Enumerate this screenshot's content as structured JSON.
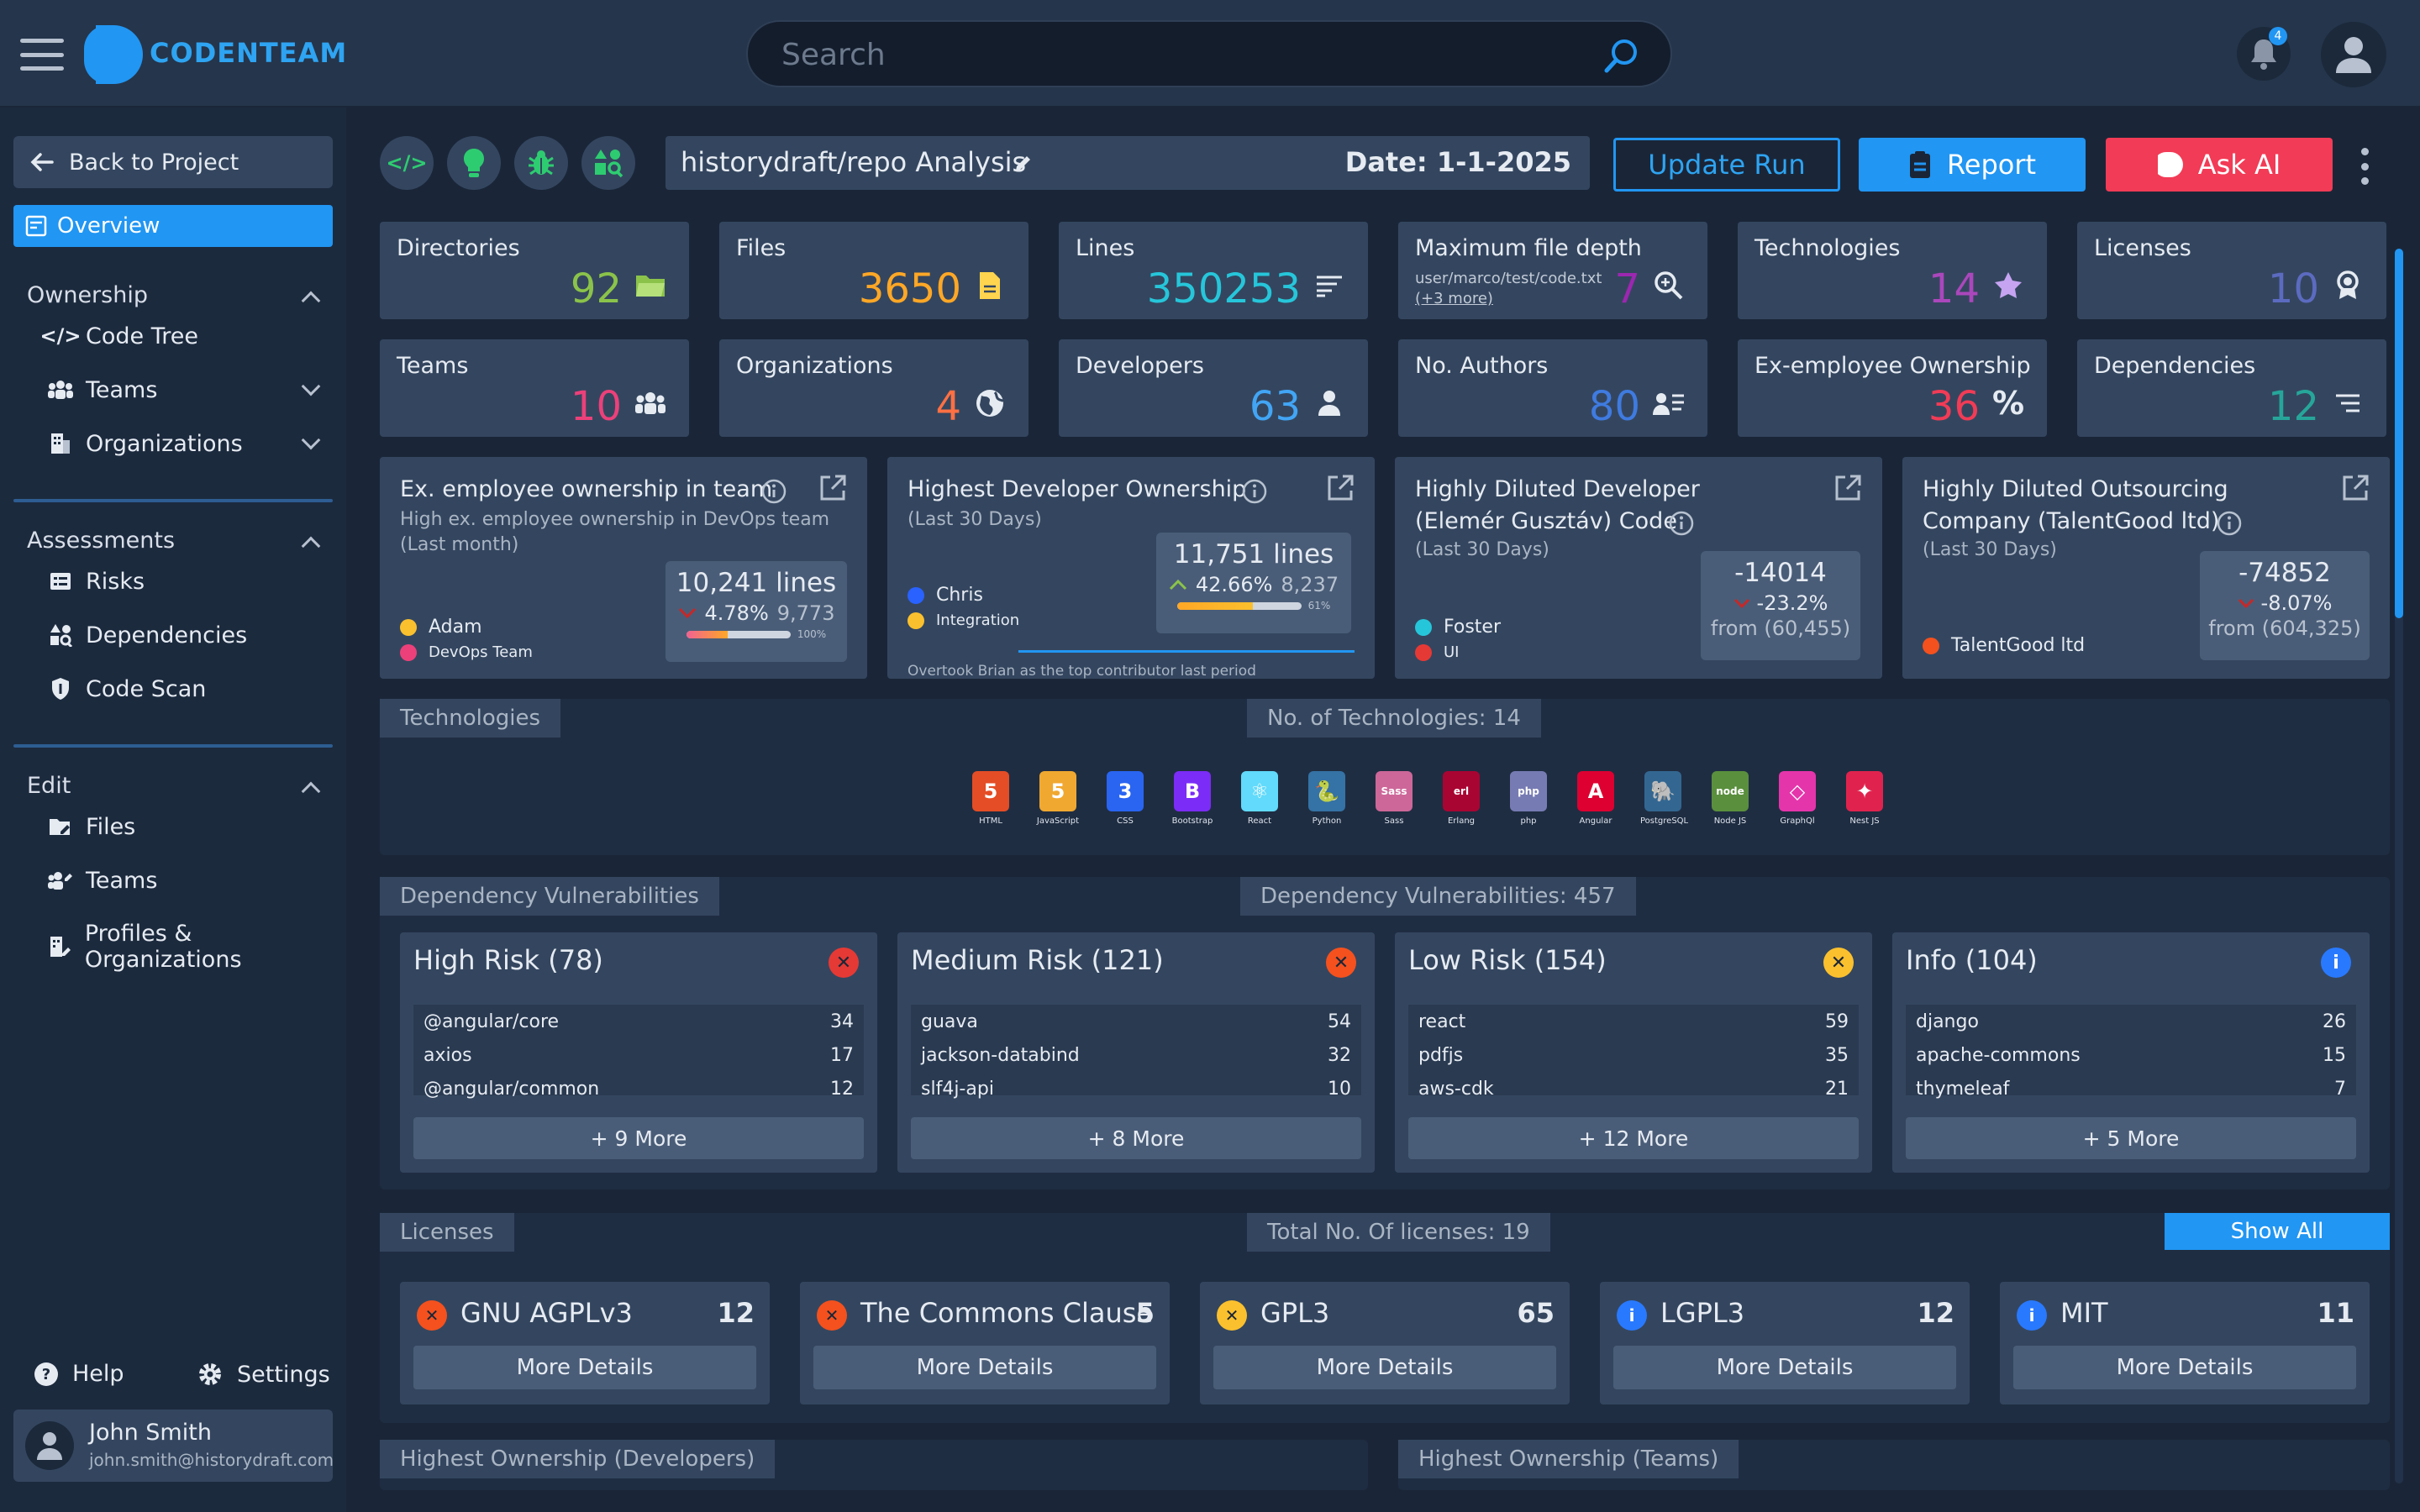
{
  "app": {
    "name": "CODENTEAM"
  },
  "search": {
    "placeholder": "Search"
  },
  "notifications": {
    "count": "4"
  },
  "sidebar": {
    "back": "Back to Project",
    "overview": "Overview",
    "ownership": "Ownership",
    "code_tree": "Code Tree",
    "teams": "Teams",
    "organizations": "Organizations",
    "assessments": "Assessments",
    "risks": "Risks",
    "dependencies": "Dependencies",
    "code_scan": "Code Scan",
    "edit": "Edit",
    "files": "Files",
    "edit_teams": "Teams",
    "profiles": "Profiles & Organizations",
    "help": "Help",
    "settings": "Settings",
    "user_name": "John Smith",
    "user_email": "john.smith@historydraft.com"
  },
  "toolbar": {
    "project": "historydraft/repo Analysis",
    "date": "Date: 1-1-2025",
    "update_run": "Update Run",
    "report": "Report",
    "ask_ai": "Ask AI"
  },
  "stats": [
    {
      "label": "Directories",
      "value": "92",
      "color": "#8bc34a",
      "icon": "folder-icon"
    },
    {
      "label": "Files",
      "value": "3650",
      "color": "#ffa726",
      "icon": "file-icon"
    },
    {
      "label": "Lines",
      "value": "350253",
      "color": "#26c6da",
      "icon": "lines-icon"
    },
    {
      "label": "Maximum file depth",
      "value": "7",
      "color": "#9c27b0",
      "icon": "zoom-icon",
      "sub": "user/marco/test/code.txt",
      "sub2": "(+3 more)"
    },
    {
      "label": "Technologies",
      "value": "14",
      "color": "#ab47bc",
      "icon": "star-icon"
    },
    {
      "label": "Licenses",
      "value": "10",
      "color": "#5c6bc0",
      "icon": "award-icon"
    },
    {
      "label": "Teams",
      "value": "10",
      "color": "#ec407a",
      "icon": "team-icon"
    },
    {
      "label": "Organizations",
      "value": "4",
      "color": "#ff7043",
      "icon": "globe-icon"
    },
    {
      "label": "Developers",
      "value": "63",
      "color": "#42a5f5",
      "icon": "person-icon"
    },
    {
      "label": "No. Authors",
      "value": "80",
      "color": "#3f7be0",
      "icon": "authors-icon"
    },
    {
      "label": "Ex-employee Ownership",
      "value": "36",
      "color": "#f23b56",
      "icon": "percent-icon"
    },
    {
      "label": "Dependencies",
      "value": "12",
      "color": "#26a69a",
      "icon": "list-icon"
    }
  ],
  "cards": {
    "c1": {
      "title": "Ex. employee ownership in team",
      "sub1": "High ex. employee ownership in DevOps team",
      "sub2": "(Last month)",
      "leg1": "Adam",
      "leg2": "DevOps Team",
      "big": "10,241 lines",
      "pct": "4.78%",
      "prev": "9,773",
      "bar": "100%",
      "fill": 0.4
    },
    "c2": {
      "title": "Highest Developer Ownership",
      "sub1": "(Last 30 Days)",
      "leg1": "Chris",
      "leg2": "Integration",
      "big": "11,751 lines",
      "pct": "42.66%",
      "prev": "8,237",
      "bar": "61%",
      "fill": 0.61,
      "note": "Overtook Brian as the top contributor last period"
    },
    "c3": {
      "title1": "Highly Diluted Developer",
      "title2": "(Elemér Gusztáv) Code",
      "sub1": "(Last 30 Days)",
      "leg1": "Foster",
      "leg2": "UI",
      "big": "-14014",
      "pct": "-23.2%",
      "from": "from (60,455)"
    },
    "c4": {
      "title1": "Highly Diluted Outsourcing",
      "title2": "Company (TalentGood ltd)",
      "sub1": "(Last 30 Days)",
      "leg1": "TalentGood ltd",
      "big": "-74852",
      "pct": "-8.07%",
      "from": "from (604,325)"
    }
  },
  "technologies": {
    "tag": "Technologies",
    "count": "No. of Technologies: 14",
    "items": [
      {
        "name": "HTML",
        "color": "#e44d26",
        "glyph": "5"
      },
      {
        "name": "JavaScript",
        "color": "#f0a830",
        "glyph": "5"
      },
      {
        "name": "CSS",
        "color": "#2965f1",
        "glyph": "3"
      },
      {
        "name": "Bootstrap",
        "color": "#7b2cf6",
        "glyph": "B"
      },
      {
        "name": "React",
        "color": "#61dafb",
        "glyph": "⚛"
      },
      {
        "name": "Python",
        "color": "#3572a5",
        "glyph": "🐍"
      },
      {
        "name": "Sass",
        "color": "#cd6799",
        "glyph": "Sass"
      },
      {
        "name": "Erlang",
        "color": "#a90533",
        "glyph": "erl"
      },
      {
        "name": "php",
        "color": "#777bb3",
        "glyph": "php"
      },
      {
        "name": "Angular",
        "color": "#dd0031",
        "glyph": "A"
      },
      {
        "name": "PostgreSQL",
        "color": "#336791",
        "glyph": "🐘"
      },
      {
        "name": "Node JS",
        "color": "#5a8f3d",
        "glyph": "node"
      },
      {
        "name": "GraphQl",
        "color": "#e535ab",
        "glyph": "◇"
      },
      {
        "name": "Nest JS",
        "color": "#e0234e",
        "glyph": "✦"
      }
    ]
  },
  "vulns": {
    "tag": "Dependency Vulnerabilities",
    "count": "Dependency Vulnerabilities: 457",
    "groups": [
      {
        "title": "High Risk (78)",
        "color": "#e53935",
        "mark": "✕",
        "rows": [
          [
            "@angular/core",
            "34"
          ],
          [
            "axios",
            "17"
          ],
          [
            "@angular/common",
            "12"
          ]
        ],
        "more": "+ 9 More"
      },
      {
        "title": "Medium Risk (121)",
        "color": "#f4511e",
        "mark": "✕",
        "rows": [
          [
            "guava",
            "54"
          ],
          [
            "jackson-databind",
            "32"
          ],
          [
            "slf4j-api",
            "10"
          ]
        ],
        "more": "+ 8 More"
      },
      {
        "title": "Low Risk (154)",
        "color": "#fbc02d",
        "mark": "✕",
        "rows": [
          [
            "react",
            "59"
          ],
          [
            "pdfjs",
            "35"
          ],
          [
            "aws-cdk",
            "21"
          ]
        ],
        "more": "+ 12 More"
      },
      {
        "title": "Info (104)",
        "color": "#2979ff",
        "mark": "i",
        "rows": [
          [
            "django",
            "26"
          ],
          [
            "apache-commons",
            "15"
          ],
          [
            "thymeleaf",
            "7"
          ]
        ],
        "more": "+ 5 More"
      }
    ]
  },
  "licenses": {
    "tag": "Licenses",
    "count": "Total No. Of licenses: 19",
    "show_all": "Show All",
    "details": "More Details",
    "items": [
      {
        "name": "GNU AGPLv3",
        "count": "12",
        "color": "#f4511e",
        "mark": "✕"
      },
      {
        "name": "The Commons Clause",
        "count": "5",
        "color": "#f4511e",
        "mark": "✕"
      },
      {
        "name": "GPL3",
        "count": "65",
        "color": "#fbc02d",
        "mark": "✕"
      },
      {
        "name": "LGPL3",
        "count": "12",
        "color": "#2979ff",
        "mark": "i"
      },
      {
        "name": "MIT",
        "count": "11",
        "color": "#2979ff",
        "mark": "i"
      }
    ]
  },
  "bottom": {
    "dev_tag": "Highest Ownership (Developers)",
    "team_tag": "Highest Ownership (Teams)"
  }
}
